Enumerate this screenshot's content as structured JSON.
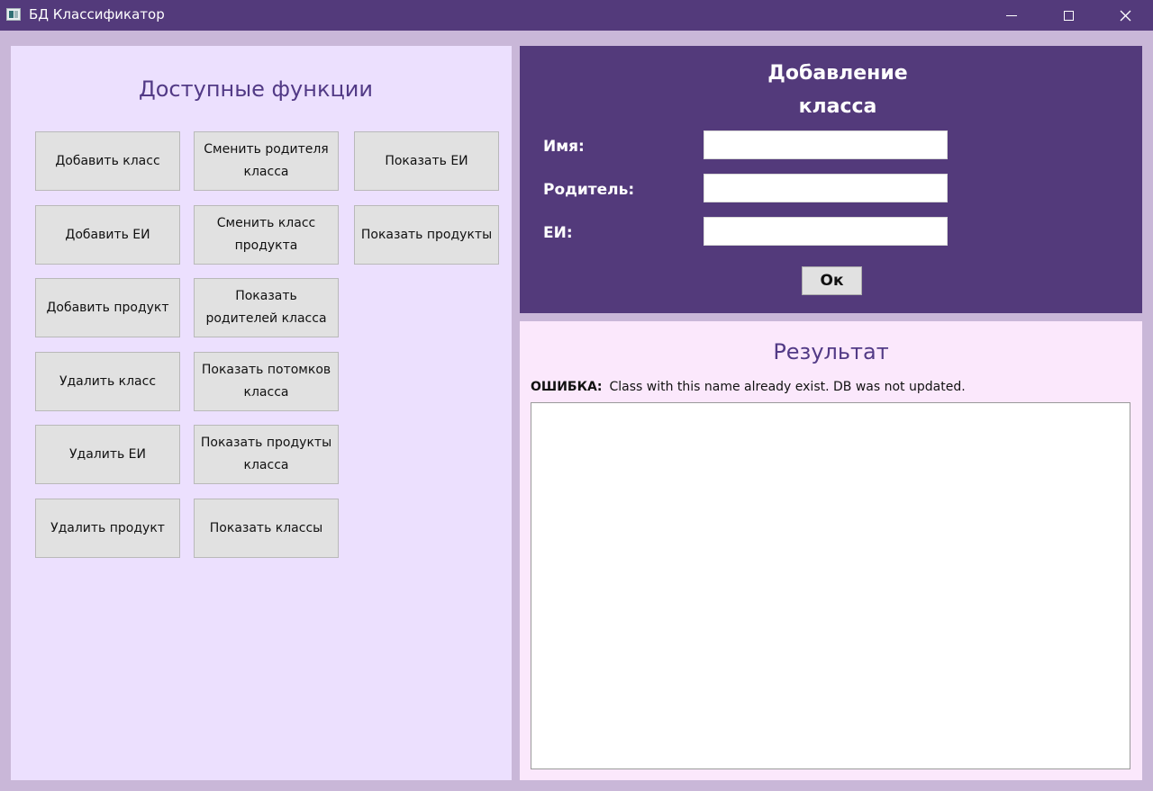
{
  "window": {
    "title": "БД Классификатор",
    "controls": {
      "minimize": "minimize-icon",
      "maximize": "maximize-icon",
      "close": "close-icon"
    }
  },
  "functions": {
    "heading": "Доступные функции",
    "buttons": [
      "Добавить класс",
      "Сменить родителя\nкласса",
      "Показать ЕИ",
      "Добавить ЕИ",
      "Сменить класс\nпродукта",
      "Показать продукты",
      "Добавить продукт",
      "Показать\nродителей класса",
      "Удалить класс",
      "Показать потомков\nкласса",
      "Удалить ЕИ",
      "Показать продукты\nкласса",
      "Удалить продукт",
      "Показать классы"
    ]
  },
  "form": {
    "title": "Добавление\nкласса",
    "fields": [
      {
        "label": "Имя:",
        "value": ""
      },
      {
        "label": "Родитель:",
        "value": ""
      },
      {
        "label": "ЕИ:",
        "value": ""
      }
    ],
    "ok_label": "Ок"
  },
  "result": {
    "heading": "Результат",
    "status_label": "ОШИБКА:",
    "status_message": "Class with this name already exist. DB was not updated.",
    "output": ""
  },
  "colors": {
    "accent": "#533a7b",
    "left_panel": "#ece0fe",
    "result_panel": "#fbe8fc",
    "window_bg": "#c9b7d8"
  }
}
